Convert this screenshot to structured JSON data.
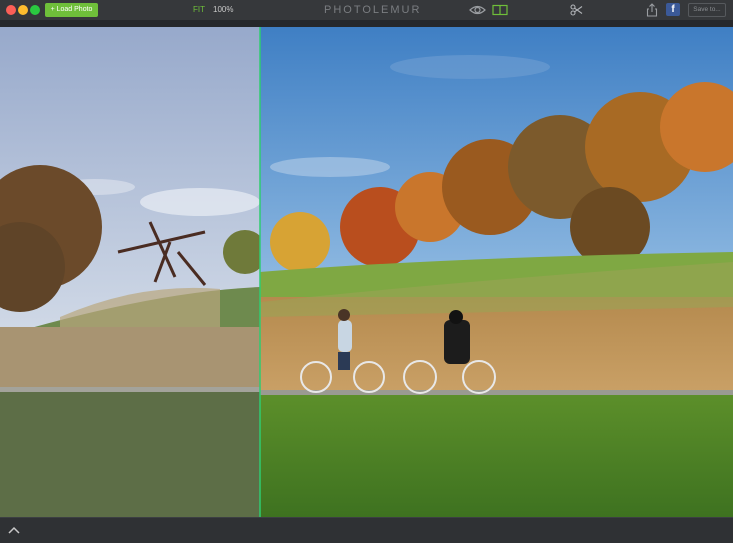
{
  "window": {
    "title": "PHOTOLEMUR"
  },
  "toolbar": {
    "load_label": "+ Load Photo",
    "fit_label": "FIT",
    "zoom_label": "100%",
    "save_label": "Save to..."
  },
  "icons": {
    "view": "eye-icon",
    "compare": "split-view-icon",
    "crop": "scissors-icon",
    "share": "share-icon",
    "social": "facebook-icon",
    "collapse": "chevron-up-icon"
  },
  "colors": {
    "accent": "#6fbf3a",
    "divider": "#2ecc71",
    "facebook": "#3b5998"
  },
  "compare_view": {
    "split_position": 0.355
  }
}
